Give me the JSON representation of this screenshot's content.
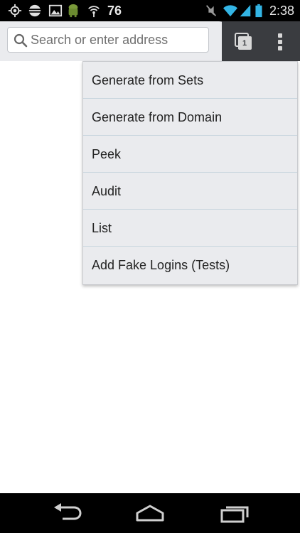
{
  "status_bar": {
    "icons_left": [
      "gps-icon",
      "sync-icon",
      "image-icon",
      "android-icon",
      "wifi-hotspot-icon"
    ],
    "battery_percent_text": "76",
    "icons_right": [
      "mute-icon",
      "wifi-icon",
      "signal-icon",
      "battery-icon"
    ],
    "time": "2:38"
  },
  "toolbar": {
    "address_placeholder": "Search or enter address",
    "address_value": "",
    "tab_count": "1"
  },
  "menu": {
    "items": [
      {
        "label": "Generate from Sets"
      },
      {
        "label": "Generate from Domain"
      },
      {
        "label": "Peek"
      },
      {
        "label": "Audit"
      },
      {
        "label": "List"
      },
      {
        "label": "Add Fake Logins (Tests)"
      }
    ]
  },
  "nav_bar": {
    "buttons": [
      "back-icon",
      "home-icon",
      "recents-icon"
    ]
  },
  "colors": {
    "status_bar_bg": "#000000",
    "toolbar_bg": "#eaebee",
    "toolbar_dark": "#3a3c40",
    "menu_bg": "#eaebee",
    "menu_divider": "#c9d6de",
    "wifi_blue": "#33b5e5"
  }
}
